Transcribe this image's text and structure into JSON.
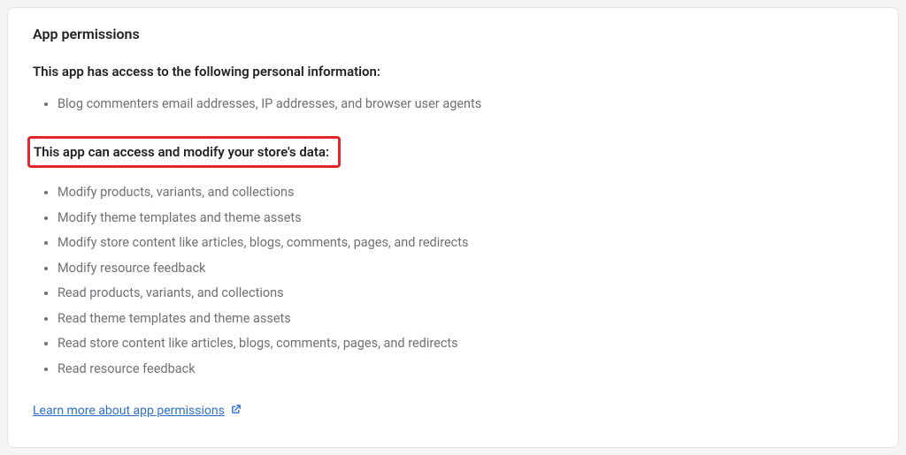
{
  "card": {
    "title": "App permissions",
    "personal_info": {
      "heading": "This app has access to the following personal information:",
      "items": [
        "Blog commenters email addresses, IP addresses, and browser user agents"
      ]
    },
    "store_data": {
      "heading": "This app can access and modify your store's data:",
      "items": [
        "Modify products, variants, and collections",
        "Modify theme templates and theme assets",
        "Modify store content like articles, blogs, comments, pages, and redirects",
        "Modify resource feedback",
        "Read products, variants, and collections",
        "Read theme templates and theme assets",
        "Read store content like articles, blogs, comments, pages, and redirects",
        "Read resource feedback"
      ]
    },
    "learn_more_label": "Learn more about app permissions"
  }
}
